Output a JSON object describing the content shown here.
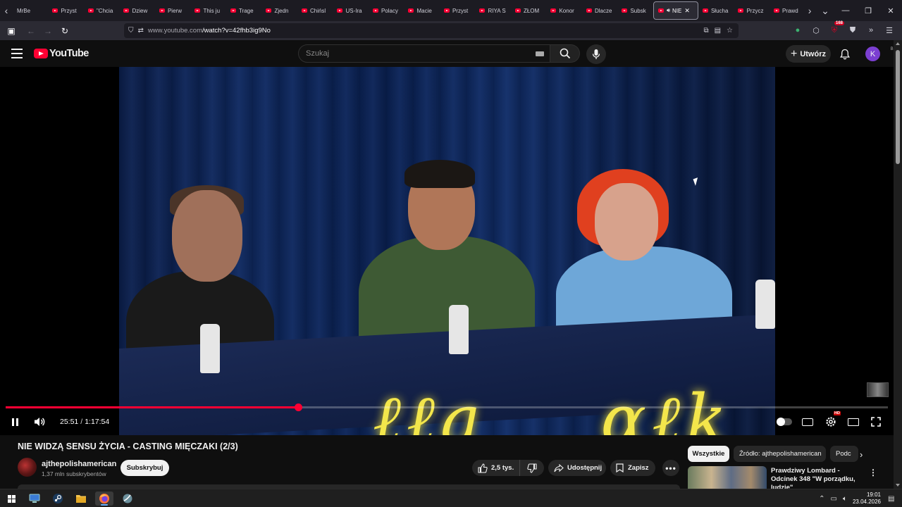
{
  "browser": {
    "tabs": [
      {
        "label": "MrBe",
        "favicon": "none"
      },
      {
        "label": "Przyst",
        "favicon": "youtube-icon"
      },
      {
        "label": "\"Chcia",
        "favicon": "youtube-icon"
      },
      {
        "label": "Dziew",
        "favicon": "youtube-icon"
      },
      {
        "label": "Pierw",
        "favicon": "youtube-icon"
      },
      {
        "label": "This ju",
        "favicon": "youtube-icon"
      },
      {
        "label": "Trage",
        "favicon": "youtube-icon"
      },
      {
        "label": "Zjedn",
        "favicon": "youtube-icon"
      },
      {
        "label": "Chińsl",
        "favicon": "youtube-icon"
      },
      {
        "label": "US-Ira",
        "favicon": "youtube-icon"
      },
      {
        "label": "Polacy",
        "favicon": "youtube-icon"
      },
      {
        "label": "Macie",
        "favicon": "youtube-icon"
      },
      {
        "label": "Przyst",
        "favicon": "youtube-icon"
      },
      {
        "label": "RIYA S",
        "favicon": "youtube-icon"
      },
      {
        "label": "ZŁOM",
        "favicon": "youtube-icon"
      },
      {
        "label": "Konor",
        "favicon": "youtube-icon"
      },
      {
        "label": "Dlacze",
        "favicon": "youtube-icon"
      },
      {
        "label": "Subsk",
        "favicon": "youtube-icon"
      }
    ],
    "active_tab": {
      "label": "NIE"
    },
    "tabs_after": [
      {
        "label": "Słucha",
        "favicon": "youtube-icon"
      },
      {
        "label": "Przycz",
        "favicon": "youtube-icon"
      },
      {
        "label": "Prawd",
        "favicon": "youtube-icon"
      }
    ],
    "url_host": "www.youtube.com",
    "url_path": "/watch?v=42fhb3ig9No",
    "extension_badge": "168"
  },
  "youtube": {
    "logo_text": "YouTube",
    "logo_country": "BR",
    "search_placeholder": "Szukaj",
    "create_label": "Utwórz",
    "avatar_letter": "K",
    "accent": "#ff0033"
  },
  "player": {
    "current_time": "25:51",
    "duration": "1:17:54",
    "progress_fraction": 0.332,
    "hd_badge": "HD",
    "autoplay_on": false
  },
  "video": {
    "title": "NIE WIDZĄ SENSU ŻYCIA - CASTING MIĘCZAKI (2/3)",
    "channel_name": "ajthepolishamerican",
    "subscribers": "1,37 mln subskrybentów",
    "subscribe_label": "Subskrybuj",
    "likes": "2,5 tys.",
    "share_label": "Udostępnij",
    "save_label": "Zapisz"
  },
  "sidebar": {
    "chips": [
      {
        "label": "Wszystkie",
        "selected": true
      },
      {
        "label": "Źródło: ajthepolishamerican",
        "selected": false
      },
      {
        "label": "Podc",
        "selected": false
      }
    ],
    "recommendation": {
      "title": "Prawdziwy Lombard - Odcinek 348 \"W porządku, ludzie\""
    }
  },
  "taskbar": {
    "time": "19:01",
    "date": "23.04.2026"
  }
}
